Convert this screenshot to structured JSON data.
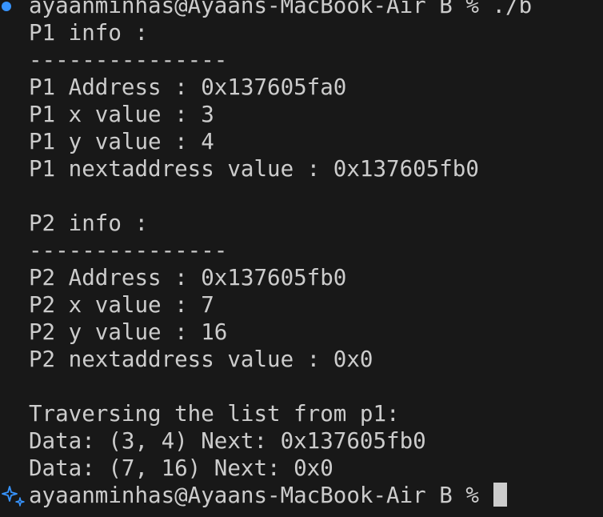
{
  "terminal": {
    "top_prompt": "ayaanminhas@Ayaans-MacBook-Air B % ./b",
    "lines": [
      "P1 info :",
      "---------------",
      "P1 Address : 0x137605fa0",
      "P1 x value : 3",
      "P1 y value : 4",
      "P1 nextaddress value : 0x137605fb0",
      "",
      "P2 info :",
      "---------------",
      "P2 Address : 0x137605fb0",
      "P2 x value : 7",
      "P2 y value : 16",
      "P2 nextaddress value : 0x0",
      "",
      "Traversing the list from p1:",
      "Data: (3, 4) Next: 0x137605fb0",
      "Data: (7, 16) Next: 0x0"
    ],
    "bottom_prompt": "ayaanminhas@Ayaans-MacBook-Air B % "
  },
  "colors": {
    "background": "#181818",
    "text": "#cccccc",
    "prompt_dot": "#3794ff",
    "sparkle": "#3794ff"
  },
  "icons": {
    "prompt_status": "circle-dot-icon",
    "ai_sparkle": "sparkle-icon"
  }
}
